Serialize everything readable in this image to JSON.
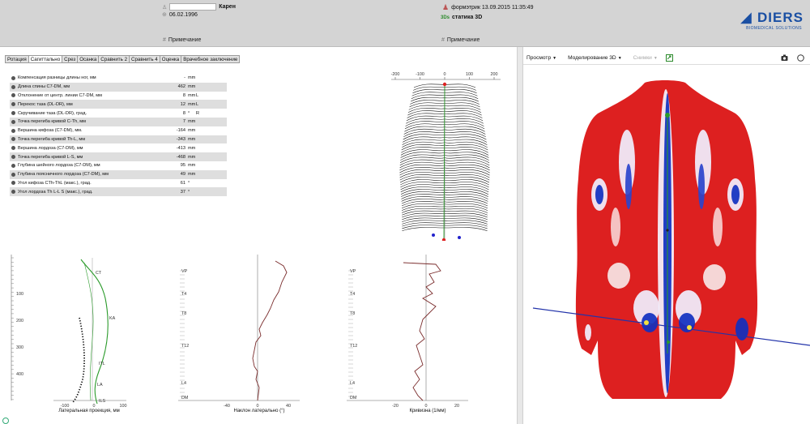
{
  "header": {
    "patient_name": "Карен",
    "birth_date": "06.02.1996",
    "device_label": "формэтрик 13.09.2015 11:35:49",
    "mode_badge": "3Ds",
    "mode_label": "статика 3D",
    "note_left": "Примечание",
    "note_right": "Примечание",
    "note_hash": "#",
    "logo_text": "DIERS",
    "logo_sub": "BIOMEDICAL SOLUTIONS"
  },
  "tabs": [
    {
      "label": "Ротация",
      "active": false
    },
    {
      "label": "Сагиттально",
      "active": true
    },
    {
      "label": "Срез",
      "active": false
    },
    {
      "label": "Осанка",
      "active": false
    },
    {
      "label": "Сравнить 2",
      "active": false
    },
    {
      "label": "Сравнить 4",
      "active": false
    },
    {
      "label": "Оценка",
      "active": false
    },
    {
      "label": "Врачебное заключение",
      "active": false
    }
  ],
  "parameters": [
    {
      "name": "Компенсация разницы длины ног, мм",
      "value": "-",
      "unit": "mm",
      "extra": ""
    },
    {
      "name": "Длина спины C7-DM, мм",
      "value": "462",
      "unit": "mm",
      "extra": ""
    },
    {
      "name": "Отклонение от центр. линии C7-DM, мм",
      "value": "8",
      "unit": "mm",
      "extra": "L"
    },
    {
      "name": "Перекос таза (DL-DR), мм",
      "value": "12",
      "unit": "mm",
      "extra": "L"
    },
    {
      "name": "Скручивание таза (DL-DR), град.",
      "value": "8",
      "unit": "°",
      "extra": "R"
    },
    {
      "name": "Точка перегиба кривой C-Th, мм",
      "value": "7",
      "unit": "mm",
      "extra": ""
    },
    {
      "name": "Вершина кифоза (C7-DM), мм.",
      "value": "-164",
      "unit": "mm",
      "extra": ""
    },
    {
      "name": "Точка перегиба кривой Th-L, мм",
      "value": "-343",
      "unit": "mm",
      "extra": ""
    },
    {
      "name": "Вершина лордоза (C7-DM), мм",
      "value": "-413",
      "unit": "mm",
      "extra": ""
    },
    {
      "name": "Точка перегиба кривой L-S, мм",
      "value": "-468",
      "unit": "mm",
      "extra": ""
    },
    {
      "name": "Глубина шейного лордоза (C7-DM), мм",
      "value": "95",
      "unit": "mm",
      "extra": ""
    },
    {
      "name": "Глубина поясничного лордоза (C7-DM), мм",
      "value": "49",
      "unit": "mm",
      "extra": ""
    },
    {
      "name": "Угол кифоза CTh-ThL (макс.), град.",
      "value": "61",
      "unit": "°",
      "extra": ""
    },
    {
      "name": "Угол лордоза Th L-L S (макс.), град.",
      "value": "37",
      "unit": "°",
      "extra": ""
    }
  ],
  "topo": {
    "x_ticks": [
      "-200",
      "-100",
      "0",
      "100",
      "200"
    ]
  },
  "plots": {
    "lateral": {
      "title": "Латеральная проекция, мм",
      "y_ticks": [
        "100",
        "200",
        "300",
        "400"
      ],
      "x_ticks": [
        "-100",
        "0",
        "100"
      ],
      "landmarks": [
        "CT",
        "KA",
        "ITL",
        "LA",
        "ILS"
      ]
    },
    "tilt": {
      "title": "Наклон латерально (°)",
      "x_ticks": [
        "-40",
        "0",
        "40"
      ],
      "y_labels": [
        "VP",
        "T4",
        "T8",
        "T12",
        "L4",
        "DM"
      ]
    },
    "curv": {
      "title": "Кривизна (1/мм)",
      "x_ticks": [
        "-20",
        "0",
        "20"
      ],
      "y_labels": [
        "VP",
        "T4",
        "T8",
        "T12",
        "L4",
        "DM"
      ]
    }
  },
  "right_toolbar": {
    "view": "Просмотр",
    "model": "Моделирование 3D",
    "snapshots": "Снимки"
  },
  "colors": {
    "header_bg": "#d4d4d4",
    "accent_blue": "#1a4fa3",
    "heat_red": "#dd2020",
    "heat_blue": "#1030c0",
    "spine_green": "#2a9a2a",
    "curve_dark": "#7a2c2c"
  }
}
